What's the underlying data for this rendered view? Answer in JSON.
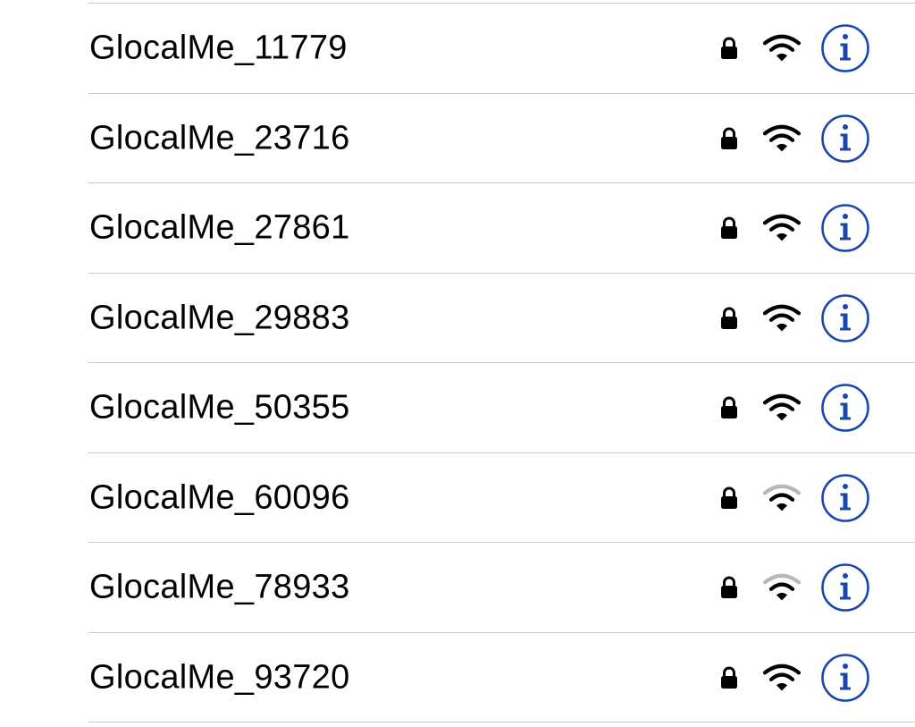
{
  "colors": {
    "text": "#000000",
    "separator": "#c8c7cc",
    "wifi_full": "#000000",
    "wifi_weak": "#b8b8b8",
    "info_accent": "#1a46b0"
  },
  "networks": [
    {
      "name": "GlocalMe_11779",
      "locked": true,
      "signal_bars": 3,
      "lock_icon": "lock-icon",
      "wifi_icon": "wifi-icon",
      "info_icon": "info-icon"
    },
    {
      "name": "GlocalMe_23716",
      "locked": true,
      "signal_bars": 3,
      "lock_icon": "lock-icon",
      "wifi_icon": "wifi-icon",
      "info_icon": "info-icon"
    },
    {
      "name": "GlocalMe_27861",
      "locked": true,
      "signal_bars": 3,
      "lock_icon": "lock-icon",
      "wifi_icon": "wifi-icon",
      "info_icon": "info-icon"
    },
    {
      "name": "GlocalMe_29883",
      "locked": true,
      "signal_bars": 3,
      "lock_icon": "lock-icon",
      "wifi_icon": "wifi-icon",
      "info_icon": "info-icon"
    },
    {
      "name": "GlocalMe_50355",
      "locked": true,
      "signal_bars": 3,
      "lock_icon": "lock-icon",
      "wifi_icon": "wifi-icon",
      "info_icon": "info-icon"
    },
    {
      "name": "GlocalMe_60096",
      "locked": true,
      "signal_bars": 2,
      "lock_icon": "lock-icon",
      "wifi_icon": "wifi-icon",
      "info_icon": "info-icon"
    },
    {
      "name": "GlocalMe_78933",
      "locked": true,
      "signal_bars": 2,
      "lock_icon": "lock-icon",
      "wifi_icon": "wifi-icon",
      "info_icon": "info-icon"
    },
    {
      "name": "GlocalMe_93720",
      "locked": true,
      "signal_bars": 3,
      "lock_icon": "lock-icon",
      "wifi_icon": "wifi-icon",
      "info_icon": "info-icon"
    }
  ]
}
